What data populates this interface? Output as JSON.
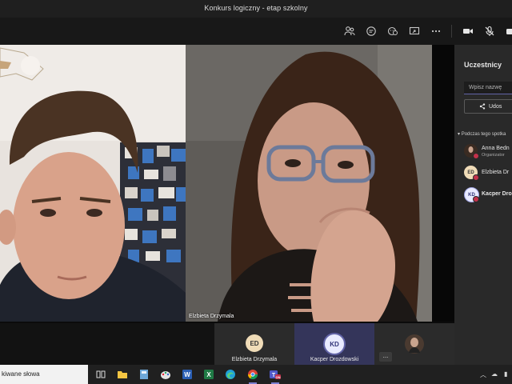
{
  "window": {
    "title": "Konkurs logiczny - etap szkolny"
  },
  "toolbar": {
    "icons": [
      "participants-icon",
      "chat-icon",
      "reactions-icon",
      "share-icon",
      "more-options-icon",
      "camera-icon",
      "mic-off-icon",
      "leave-icon"
    ]
  },
  "stage": {
    "main_video_label": "Elzbieta Drzymala"
  },
  "strip": {
    "tiles": [
      {
        "initials": "ED",
        "name": "Elzbieta Drzymala"
      },
      {
        "initials": "KD",
        "name": "Kacper Drozdowski"
      }
    ],
    "more_label": "..."
  },
  "panel": {
    "title": "Uczestnicy",
    "search_placeholder": "Wpisz nazwę",
    "share_label": "Udos",
    "section_label": "Podczas tego spotka",
    "participants": [
      {
        "name": "Anna Bedn",
        "role": "Organizator",
        "avatar": "photo"
      },
      {
        "initials": "ED",
        "name": "Elzbieta Dr",
        "role": ""
      },
      {
        "initials": "KD",
        "name": "Kacper Dro",
        "role": ""
      }
    ]
  },
  "taskbar": {
    "search_text": "kiwane słowa",
    "apps": [
      "task-view",
      "file-explorer",
      "calculator",
      "paint",
      "word",
      "excel",
      "edge",
      "chrome",
      "teams"
    ],
    "teams_badge": "ON"
  },
  "colors": {
    "accent": "#6264a7",
    "mute_red": "#c4314b",
    "panel_bg": "#292929"
  }
}
